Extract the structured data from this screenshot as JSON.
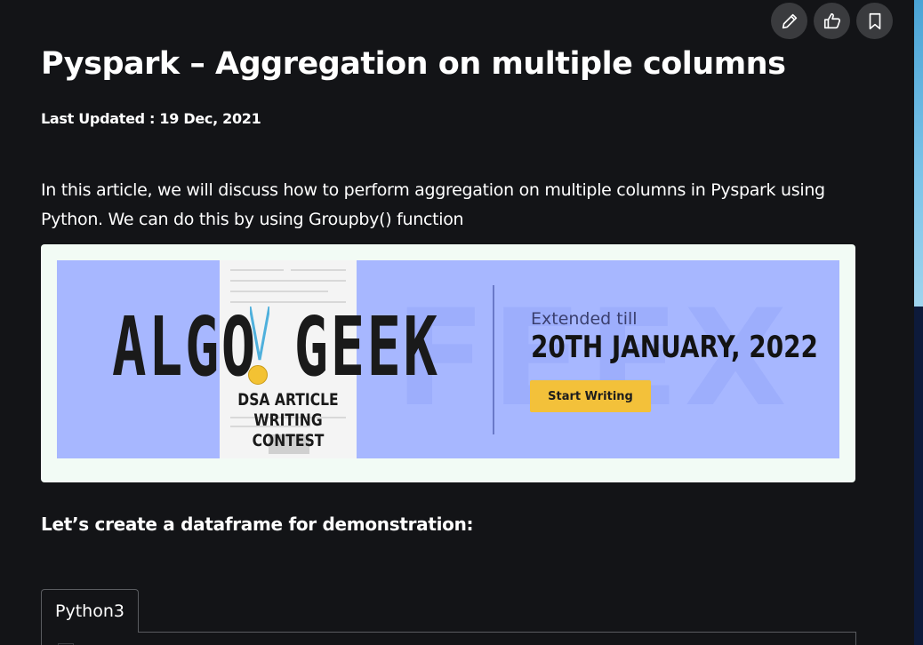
{
  "toolbar": {
    "edit_icon": "pencil-icon",
    "like_icon": "thumbs-up-icon",
    "bookmark_icon": "bookmark-icon"
  },
  "article": {
    "title": "Pyspark – Aggregation on multiple columns",
    "last_updated": "Last Updated : 19 Dec, 2021",
    "intro": "In this article, we will discuss how to perform aggregation on multiple columns in Pyspark using Python. We can do this by using Groupby() function",
    "subheading": "Let’s create a dataframe for demonstration:"
  },
  "banner": {
    "headline": "ALGO GEEK",
    "contest": "DSA ARTICLE WRITING CONTEST",
    "extended": "Extended till",
    "deadline": "20TH JANUARY, 2022",
    "cta": "Start Writing"
  },
  "code": {
    "tab_label": "Python3"
  },
  "colors": {
    "background": "#131417",
    "banner_bg": "#a7b7ff",
    "cta": "#f3c13a"
  }
}
